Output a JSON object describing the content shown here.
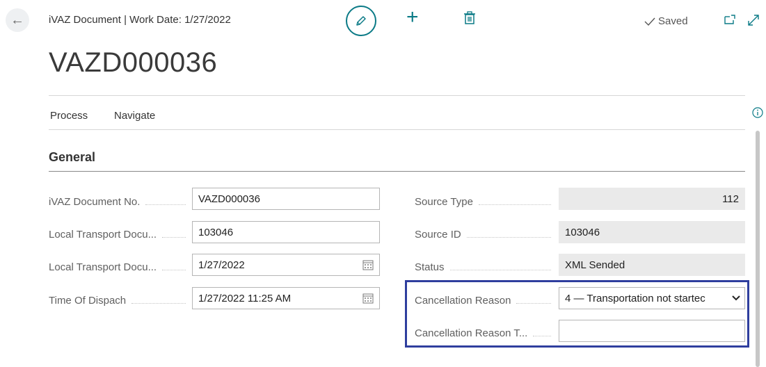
{
  "header": {
    "caption": "iVAZ Document | Work Date: 1/27/2022",
    "title": "VAZD000036",
    "saved_label": "Saved"
  },
  "menu": {
    "items": [
      "Process",
      "Navigate"
    ]
  },
  "section": {
    "title": "General"
  },
  "left_fields": [
    {
      "label": "iVAZ Document No.",
      "value": "VAZD000036",
      "icon": null
    },
    {
      "label": "Local Transport Docu...",
      "value": "103046",
      "icon": null
    },
    {
      "label": "Local Transport Docu...",
      "value": "1/27/2022",
      "icon": "calendar-icon"
    },
    {
      "label": "Time Of Dispach",
      "value": "1/27/2022 11:25 AM",
      "icon": "calendar-icon"
    }
  ],
  "right_fields": [
    {
      "label": "Source Type",
      "value": "112"
    },
    {
      "label": "Source ID",
      "value": "103046"
    },
    {
      "label": "Status",
      "value": "XML Sended"
    },
    {
      "label": "Cancellation Reason",
      "value": "4 — Transportation not startec"
    },
    {
      "label": "Cancellation Reason T...",
      "value": ""
    }
  ],
  "colors": {
    "accent": "#0a7a86",
    "highlight_border": "#2f3e9e",
    "readonly_bg": "#eaeaea"
  },
  "icons": [
    "back-arrow-icon",
    "pencil-icon",
    "plus-icon",
    "trash-icon",
    "checkmark-icon",
    "open-in-new-window-icon",
    "expand-icon",
    "info-icon",
    "calendar-icon",
    "chevron-down-icon"
  ]
}
